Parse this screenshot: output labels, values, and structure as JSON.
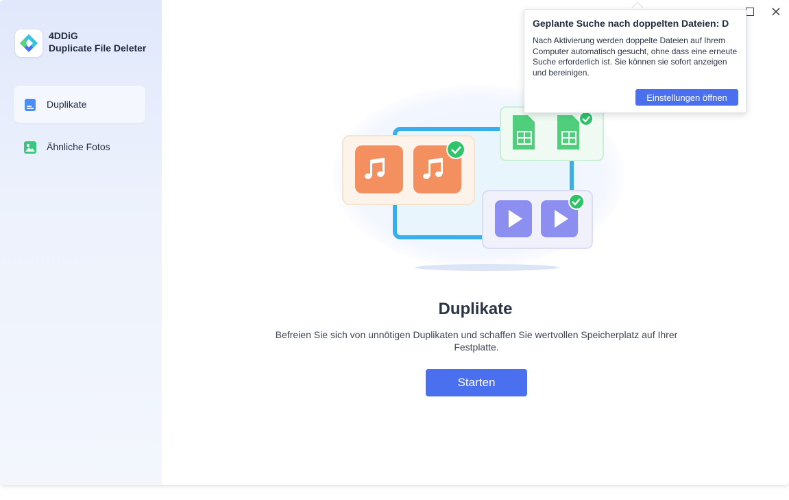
{
  "app": {
    "brand_line1": "4DDiG",
    "brand_line2": "Duplicate File Deleter"
  },
  "sidebar": {
    "items": [
      {
        "label": "Duplikate",
        "icon": "document-icon",
        "active": true
      },
      {
        "label": "Ähnliche Fotos",
        "icon": "image-icon",
        "active": false
      }
    ]
  },
  "main": {
    "heading": "Duplikate",
    "description": "Befreien Sie sich von unnötigen Duplikaten und schaffen Sie wertvollen Speicherplatz auf Ihrer Festplatte.",
    "start_label": "Starten"
  },
  "popup": {
    "title": "Geplante Suche nach doppelten Dateien: D",
    "body": "Nach Aktivierung werden doppelte Dateien auf Ihrem Computer automatisch gesucht, ohne dass eine erneute Suche erforderlich ist. Sie können sie sofort anzeigen und bereinigen.",
    "button_label": "Einstellungen öffnen"
  },
  "colors": {
    "accent": "#4a70f0",
    "music": "#f4905f",
    "sheet": "#4fcf7c",
    "video": "#8c8ff0",
    "check": "#2fc46a",
    "frame": "#3aaeea"
  }
}
